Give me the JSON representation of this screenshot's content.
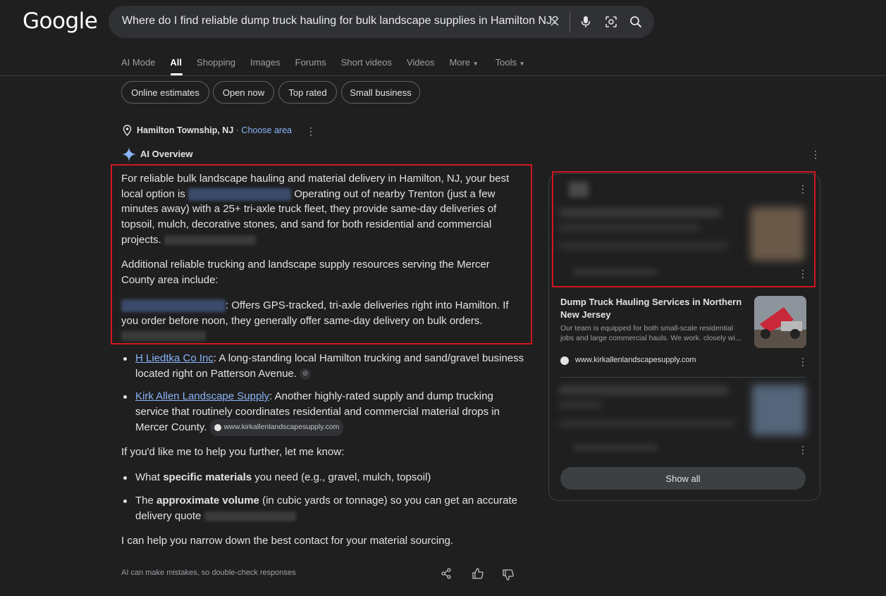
{
  "logo": "Google",
  "search": {
    "query": "Where do I find reliable dump truck hauling for bulk landscape supplies in Hamilton NJ?",
    "icons": [
      "close-icon",
      "mic-icon",
      "lens-icon",
      "search-icon"
    ]
  },
  "tabs": [
    {
      "label": "AI Mode",
      "active": false
    },
    {
      "label": "All",
      "active": true
    },
    {
      "label": "Shopping",
      "active": false
    },
    {
      "label": "Images",
      "active": false
    },
    {
      "label": "Forums",
      "active": false
    },
    {
      "label": "Short videos",
      "active": false
    },
    {
      "label": "Videos",
      "active": false
    },
    {
      "label": "More",
      "active": false
    },
    {
      "label": "Tools",
      "active": false
    }
  ],
  "chips": [
    "Online estimates",
    "Open now",
    "Top rated",
    "Small business"
  ],
  "location": {
    "place": "Hamilton Township, NJ",
    "sep": "·",
    "choose": "Choose area"
  },
  "ai_overview": {
    "label": "AI Overview",
    "p1_a": "For reliable bulk landscape hauling and material delivery in Hamilton, NJ, your best local option is",
    "p1_b": "Operating out of nearby Trenton (just a few minutes away) with a 25+ tri-axle truck fleet, they provide same-day deliveries of topsoil, mulch, decorative stones, and sand for both residential and commercial projects.",
    "p2": "Additional reliable trucking and landscape supply resources serving the Mercer County area include:",
    "b1_tail": ": Offers GPS-tracked, tri-axle deliveries right into Hamilton. If you order before noon, they generally offer same-day delivery on bulk orders.",
    "b2_link": "H Liedtka Co Inc",
    "b2_text": ": A long-standing local Hamilton trucking and sand/gravel business located right on Patterson Avenue.",
    "b3_link": "Kirk Allen Landscape Supply",
    "b3_text": ": Another highly-rated supply and dump trucking service that routinely coordinates residential and commercial material drops in Mercer County.",
    "b3_src": "www.kirkallenlandscapesupply.com",
    "p3": "If you'd like me to help you further, let me know:",
    "q1_pre": "What ",
    "q1_bold": "specific materials",
    "q1_post": " you need (e.g., gravel, mulch, topsoil)",
    "q2_pre": "The ",
    "q2_bold": "approximate volume",
    "q2_post": " (in cubic yards or tonnage) so you can get an accurate delivery quote",
    "p4": "I can help you narrow down the best contact for your material sourcing.",
    "disclaimer": "AI can make mistakes, so double-check responses"
  },
  "sources": {
    "card2_title": "Dump Truck Hauling Services in Northern New Jersey",
    "card2_desc": "Our team is equipped for both small-scale residential jobs and large commercial hauls. We work. closely wi...",
    "card2_site": "www.kirkallenlandscapesupply.com",
    "show_all": "Show all"
  },
  "colors": {
    "background": "#1f1f1f",
    "link": "#8ab4f8",
    "highlight_box": "#d0161f"
  }
}
